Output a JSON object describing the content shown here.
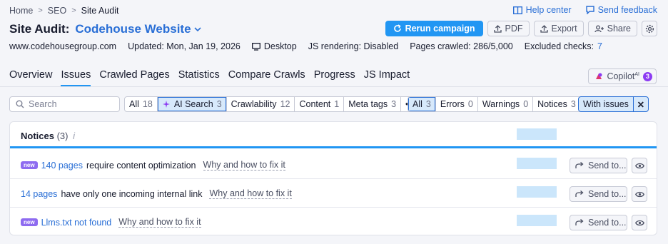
{
  "breadcrumb": [
    "Home",
    "SEO",
    "Site Audit"
  ],
  "help": {
    "help_center": "Help center",
    "send_feedback": "Send feedback"
  },
  "title": {
    "prefix": "Site Audit:",
    "project": "Codehouse Website"
  },
  "actions": {
    "rerun": "Rerun campaign",
    "pdf": "PDF",
    "export": "Export",
    "share": "Share"
  },
  "meta": {
    "domain": "www.codehousegroup.com",
    "updated": "Updated: Mon, Jan 19, 2026",
    "device": "Desktop",
    "js_rendering": "JS rendering: Disabled",
    "pages_crawled": "Pages crawled: 286/5,000",
    "excluded_label": "Excluded checks:",
    "excluded_value": "7"
  },
  "tabs": [
    "Overview",
    "Issues",
    "Crawled Pages",
    "Statistics",
    "Compare Crawls",
    "Progress",
    "JS Impact"
  ],
  "copilot": {
    "label": "Copilot",
    "sup": "AI",
    "count": "3"
  },
  "search": {
    "placeholder": "Search"
  },
  "categories": [
    {
      "label": "All",
      "count": "18"
    },
    {
      "label": "AI Search",
      "count": "3"
    },
    {
      "label": "Crawlability",
      "count": "12"
    },
    {
      "label": "Content",
      "count": "1"
    },
    {
      "label": "Meta tags",
      "count": "3"
    },
    {
      "label": "•••",
      "count": ""
    }
  ],
  "types": [
    {
      "label": "All",
      "count": "3"
    },
    {
      "label": "Errors",
      "count": "0"
    },
    {
      "label": "Warnings",
      "count": "0"
    },
    {
      "label": "Notices",
      "count": "3"
    }
  ],
  "with_issues": "With issues",
  "notices": {
    "title": "Notices",
    "count": "(3)",
    "rows": [
      {
        "new": "new",
        "link": "140 pages",
        "text": "require content optimization",
        "why": "Why and how to fix it",
        "send": "Send to..."
      },
      {
        "new": "",
        "link": "14 pages",
        "text": "have only one incoming internal link",
        "why": "Why and how to fix it",
        "send": "Send to..."
      },
      {
        "new": "new",
        "link": "Llms.txt not found",
        "text": "",
        "why": "Why and how to fix it",
        "send": "Send to..."
      }
    ]
  },
  "colors": {
    "accent": "#2196f3",
    "link": "#2a6fd6",
    "new_badge": "#8e6bf0"
  }
}
